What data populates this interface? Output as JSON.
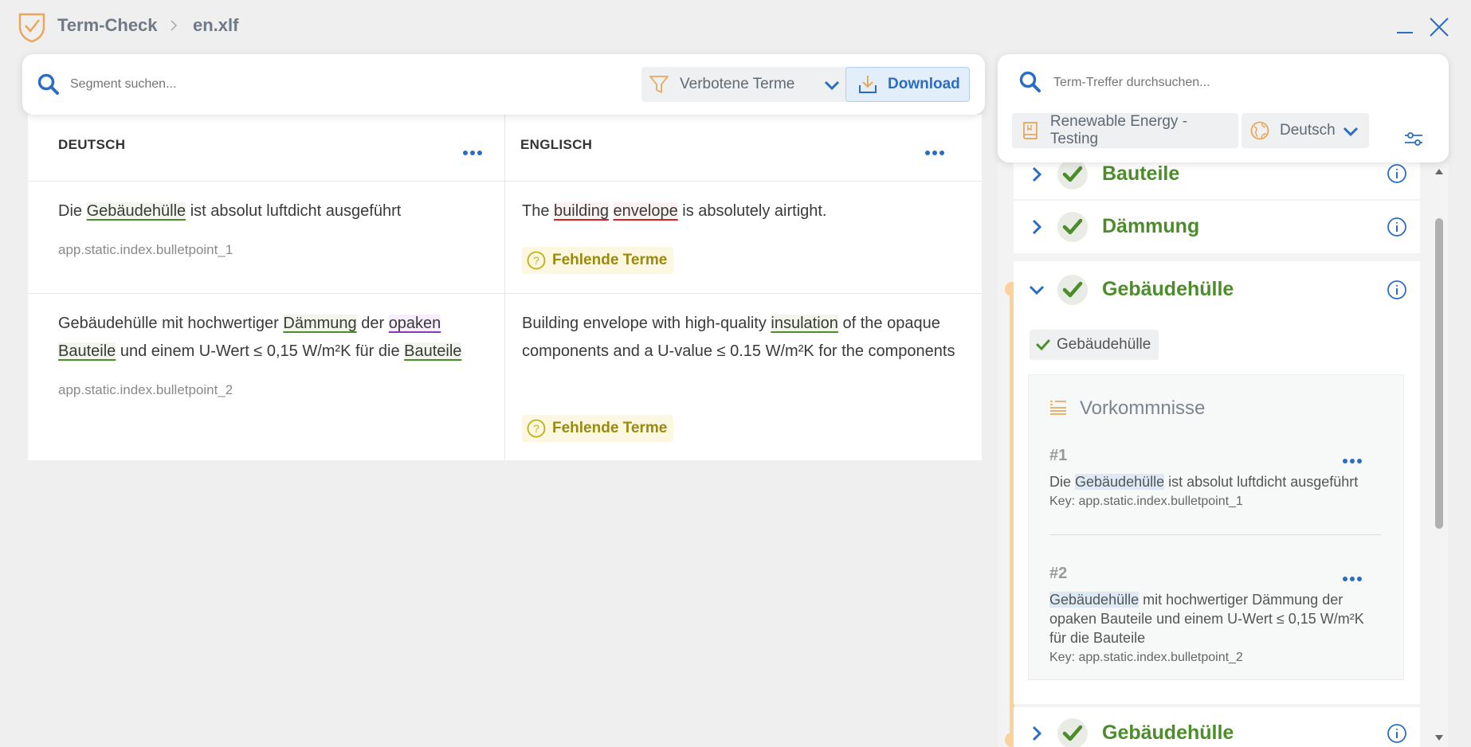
{
  "titlebar": {
    "app_name": "Term-Check",
    "file_name": "en.xlf"
  },
  "toolbar": {
    "search_placeholder": "Segment suchen...",
    "filter_label": "Verbotene Terme",
    "download_label": "Download"
  },
  "table": {
    "source_header": "DEUTSCH",
    "target_header": "ENGLISCH",
    "missing_label": "Fehlende Terme",
    "rows": [
      {
        "source": {
          "pre": "Die ",
          "t1": "Gebäudehülle",
          "post": " ist absolut luftdicht ausgeführt"
        },
        "key": "app.static.index.bulletpoint_1",
        "target": {
          "pre": "The ",
          "t1": "building",
          "mid": " ",
          "t2": "envelope",
          "post": " is absolutely airtight."
        }
      },
      {
        "source": {
          "pre": "Gebäudehülle mit hochwertiger ",
          "t1": "Dämmung",
          "mid1": " der ",
          "t2": "opaken",
          "mid2": " ",
          "t3": "Bauteile",
          "mid3": " und einem U-Wert ≤ 0,15 W/m²K für die ",
          "t4": "Bauteile"
        },
        "key": "app.static.index.bulletpoint_2",
        "target": {
          "pre": "Building envelope with high-quality ",
          "t1": "insulation",
          "post": " of the opaque components and a U-value ≤ 0.15 W/m²K for the components"
        }
      }
    ]
  },
  "termpanel": {
    "search_placeholder": "Term-Treffer durchsuchen...",
    "termbase": "Renewable Energy - Testing",
    "language": "Deutsch",
    "terms": [
      "Bauteile",
      "Dämmung",
      "Gebäudehülle",
      "Gebäudehülle"
    ],
    "variant": "Gebäudehülle",
    "occurrences_title": "Vorkommnisse",
    "occurrences": [
      {
        "num": "#1",
        "pre": "Die ",
        "hl": "Gebäudehülle",
        "post": " ist absolut luftdicht ausgeführt",
        "key": "Key: app.static.index.bulletpoint_1"
      },
      {
        "num": "#2",
        "pre": "",
        "hl": "Gebäudehülle",
        "post": " mit hochwertiger Dämmung der opaken Bauteile und einem U-Wert ≤ 0,15 W/m²K für die Bauteile",
        "key": "Key: app.static.index.bulletpoint_2"
      }
    ]
  },
  "colors": {
    "accent": "#2b6cc4",
    "term_ok": "#4c8c2b",
    "forbidden": "#d4202a",
    "missing": "#9b8a0c",
    "timeline": "#fbd29b"
  }
}
